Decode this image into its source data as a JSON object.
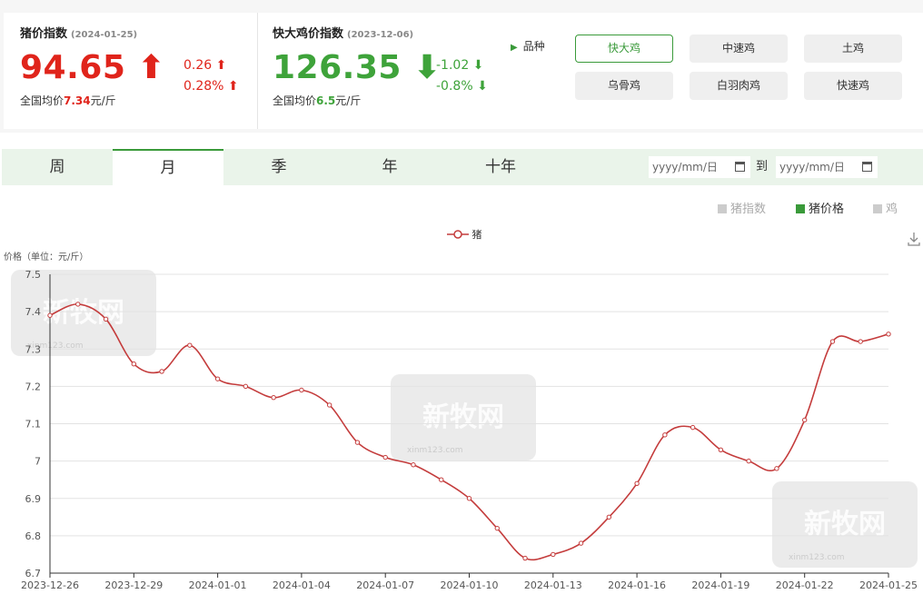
{
  "indices": [
    {
      "title": "猪价指数",
      "date": "(2024-01-25)",
      "value": "94.65",
      "arrow": "⬆",
      "change_abs": "0.26 ⬆",
      "change_pct": "0.28% ⬆",
      "avg_prefix": "全国均价",
      "avg_value": "7.34",
      "avg_unit": "元/斤"
    },
    {
      "title": "快大鸡价指数",
      "date": "(2023-12-06)",
      "value": "126.35",
      "arrow": "⬇",
      "change_abs": "-1.02 ⬇",
      "change_pct": "-0.8% ⬇",
      "avg_prefix": "全国均价",
      "avg_value": "6.5",
      "avg_unit": "元/斤"
    }
  ],
  "variety": {
    "label": "品种",
    "options": [
      "快大鸡",
      "中速鸡",
      "土鸡",
      "乌骨鸡",
      "白羽肉鸡",
      "快速鸡"
    ],
    "selected": "快大鸡"
  },
  "tabs": [
    "周",
    "月",
    "季",
    "年",
    "十年"
  ],
  "active_tab": "月",
  "date_range": {
    "from_placeholder": "yyyy/mm/日",
    "to_label": "到",
    "to_placeholder": "yyyy/mm/日"
  },
  "toggles": [
    {
      "label": "猪指数",
      "on": false
    },
    {
      "label": "猪价格",
      "on": true
    },
    {
      "label": "鸡",
      "on": false
    }
  ],
  "watermark": {
    "text": "新牧网",
    "url": "xinm123.com"
  },
  "colors": {
    "up": "#e0241b",
    "down": "#3ea33a",
    "accent": "#3a9a3a",
    "line": "#c43c3c"
  },
  "chart_data": {
    "type": "line",
    "ylabel": "价格（单位：元/斤）",
    "ylim": [
      6.7,
      7.5
    ],
    "yticks": [
      6.7,
      6.8,
      6.9,
      7,
      7.1,
      7.2,
      7.3,
      7.4,
      7.5
    ],
    "xtick_labels": [
      "2023-12-26",
      "2023-12-29",
      "2024-01-01",
      "2024-01-04",
      "2024-01-07",
      "2024-01-10",
      "2024-01-13",
      "2024-01-16",
      "2024-01-19",
      "2024-01-22",
      "2024-01-25"
    ],
    "legend": "top-center",
    "grid": true,
    "series": [
      {
        "name": "猪",
        "x": [
          "2023-12-26",
          "2023-12-27",
          "2023-12-28",
          "2023-12-29",
          "2023-12-30",
          "2023-12-31",
          "2024-01-01",
          "2024-01-02",
          "2024-01-03",
          "2024-01-04",
          "2024-01-05",
          "2024-01-06",
          "2024-01-07",
          "2024-01-08",
          "2024-01-09",
          "2024-01-10",
          "2024-01-11",
          "2024-01-12",
          "2024-01-13",
          "2024-01-14",
          "2024-01-15",
          "2024-01-16",
          "2024-01-17",
          "2024-01-18",
          "2024-01-19",
          "2024-01-20",
          "2024-01-21",
          "2024-01-22",
          "2024-01-23",
          "2024-01-24",
          "2024-01-25"
        ],
        "values": [
          7.39,
          7.42,
          7.38,
          7.26,
          7.24,
          7.31,
          7.22,
          7.2,
          7.17,
          7.19,
          7.15,
          7.05,
          7.01,
          6.99,
          6.95,
          6.9,
          6.82,
          6.74,
          6.75,
          6.78,
          6.85,
          6.94,
          7.07,
          7.09,
          7.03,
          7.0,
          6.98,
          7.11,
          7.32,
          7.32,
          7.34
        ]
      }
    ]
  }
}
